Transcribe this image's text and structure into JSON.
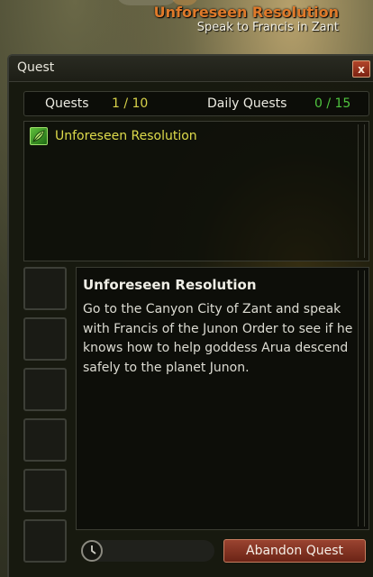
{
  "hud": {
    "quest_title": "Unforeseen Resolution",
    "quest_objective": "Speak to Francis in Zant"
  },
  "window": {
    "title": "Quest",
    "close_label": "x"
  },
  "counts": {
    "quests_label": "Quests",
    "quests_value": "1 / 10",
    "daily_label": "Daily Quests",
    "daily_value": "0 / 15"
  },
  "quest_list": [
    {
      "name": "Unforeseen Resolution",
      "icon": "quest-leaf-icon"
    }
  ],
  "detail": {
    "title": "Unforeseen Resolution",
    "description": "Go to the Canyon City of Zant and speak with Francis of the Junon Order to see if he knows how to help goddess Arua descend safely to the planet Junon."
  },
  "abandon_label": "Abandon Quest",
  "colors": {
    "hud_title": "#e07a2a",
    "quest_count": "#d8d24a",
    "daily_count": "#4fc33e",
    "abandon_button": "#8a3a26"
  }
}
